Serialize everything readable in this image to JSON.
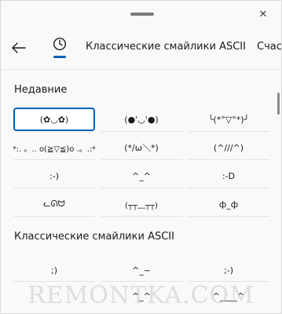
{
  "header": {
    "close_glyph": "✕"
  },
  "tabs": {
    "back_glyph": "←",
    "recent_icon": "clock-icon",
    "tab1": "Классические смайлики ASCII",
    "tab2": "Счаст"
  },
  "recent": {
    "title": "Недавние",
    "items": [
      "(✿◡✿)",
      "(●'◡'●)",
      "╰(*°▽°*)╯",
      "·*:. 。.. o(≧▽≦)o .。.:*·",
      "(*/ω＼*)",
      "(^///^)",
      ":-)",
      "^_^",
      ":-D",
      "ᓚᘏᗢ",
      "(┬┬﹏┬┬)",
      "ф_ф"
    ]
  },
  "classic": {
    "title": "Классические смайлики ASCII",
    "items": [
      ";)",
      "^_~",
      ";-)",
      "",
      "^_^",
      "^____^"
    ]
  },
  "watermark": "REMONTKA.COM"
}
